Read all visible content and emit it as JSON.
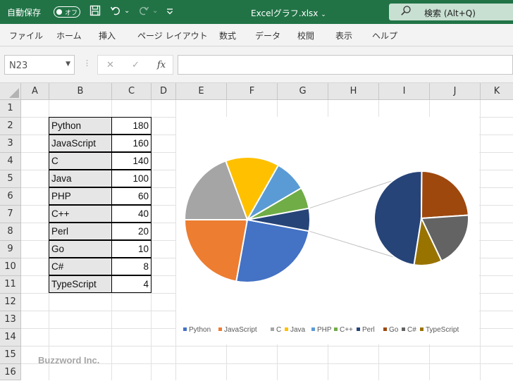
{
  "titlebar": {
    "autosave_label": "自動保存",
    "autosave_state": "オフ",
    "filename": "Excelグラフ.xlsx",
    "filename_caret": "⌄",
    "search_label": "検索 (Alt+Q)",
    "undo_caret": "⌄",
    "redo_caret": "⌄"
  },
  "menu": [
    "ファイル",
    "ホーム",
    "挿入",
    "ページ レイアウト",
    "数式",
    "データ",
    "校閲",
    "表示",
    "ヘルプ"
  ],
  "formula_bar": {
    "name_box": "N23",
    "cancel": "✕",
    "enter": "✓",
    "fx": "fx",
    "content": ""
  },
  "columns": [
    "A",
    "B",
    "C",
    "D",
    "E",
    "F",
    "G",
    "H",
    "I",
    "J",
    "K"
  ],
  "rows": [
    "1",
    "2",
    "3",
    "4",
    "5",
    "6",
    "7",
    "8",
    "9",
    "10",
    "11",
    "12",
    "13",
    "14",
    "15",
    "16"
  ],
  "table": [
    {
      "lang": "Python",
      "value": "180"
    },
    {
      "lang": "JavaScript",
      "value": "160"
    },
    {
      "lang": "C",
      "value": "140"
    },
    {
      "lang": "Java",
      "value": "100"
    },
    {
      "lang": "PHP",
      "value": "60"
    },
    {
      "lang": "C++",
      "value": "40"
    },
    {
      "lang": "Perl",
      "value": "20"
    },
    {
      "lang": "Go",
      "value": "10"
    },
    {
      "lang": "C#",
      "value": "8"
    },
    {
      "lang": "TypeScript",
      "value": "4"
    }
  ],
  "chart_data": {
    "type": "pie",
    "subtype": "pie-of-pie",
    "categories": [
      "Python",
      "JavaScript",
      "C",
      "Java",
      "PHP",
      "C++",
      "Perl",
      "Go",
      "C#",
      "TypeScript"
    ],
    "values": [
      180,
      160,
      140,
      100,
      60,
      40,
      20,
      10,
      8,
      4
    ],
    "colors": [
      "#4472c4",
      "#ed7d31",
      "#a5a5a5",
      "#ffc000",
      "#5b9bd5",
      "#70ad47",
      "#264478",
      "#9e480e",
      "#636363",
      "#997300"
    ],
    "secondary_plot_categories": [
      "Perl",
      "Go",
      "C#",
      "TypeScript"
    ],
    "legend_position": "bottom"
  },
  "watermark": "Buzzword Inc."
}
